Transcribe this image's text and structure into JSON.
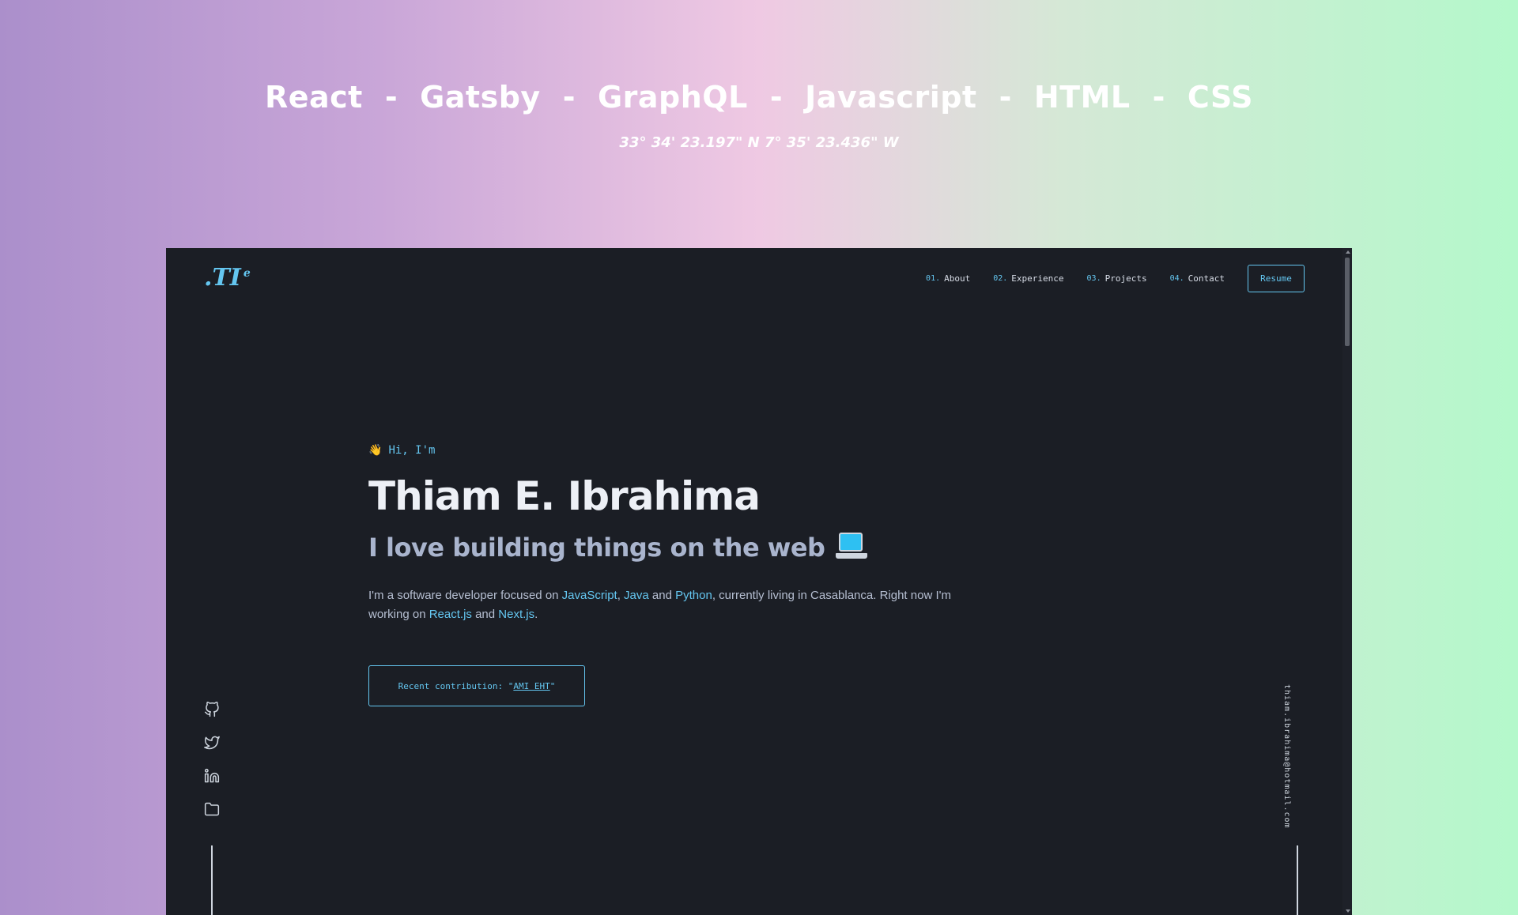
{
  "banner": {
    "technologies": [
      "React",
      "Gatsby",
      "GraphQL",
      "Javascript",
      "HTML",
      "CSS"
    ],
    "separator": "-",
    "coordinates": "33° 34' 23.197\" N 7° 35' 23.436\" W"
  },
  "site": {
    "logo": ".TI",
    "logo_sup": "e",
    "nav": [
      {
        "num": "01.",
        "label": "About"
      },
      {
        "num": "02.",
        "label": "Experience"
      },
      {
        "num": "03.",
        "label": "Projects"
      },
      {
        "num": "04.",
        "label": "Contact"
      }
    ],
    "resume_label": "Resume",
    "hero": {
      "wave_emoji": "👋",
      "greeting": "Hi, I'm",
      "name": "Thiam E. Ibrahima",
      "tagline": "I love building things on the web",
      "bio": {
        "p1": "I'm a software developer focused on ",
        "lang1": "JavaScript",
        "c1": ", ",
        "lang2": "Java",
        "c2": " and ",
        "lang3": "Python",
        "c3": ", currently living in Casablanca. Right now I'm working on ",
        "fw1": "React.js",
        "c4": " and ",
        "fw2": "Next.js",
        "c5": "."
      },
      "contribution_prefix": "Recent contribution: \"",
      "contribution_link": "AMI EHT",
      "contribution_suffix": "\""
    },
    "socials": [
      "github-icon",
      "twitter-icon",
      "linkedin-icon",
      "folder-icon"
    ],
    "email": "thiam.ibrahima@hotmail.com",
    "accent_color": "#64c6f0",
    "background_color": "#1b1e25"
  }
}
